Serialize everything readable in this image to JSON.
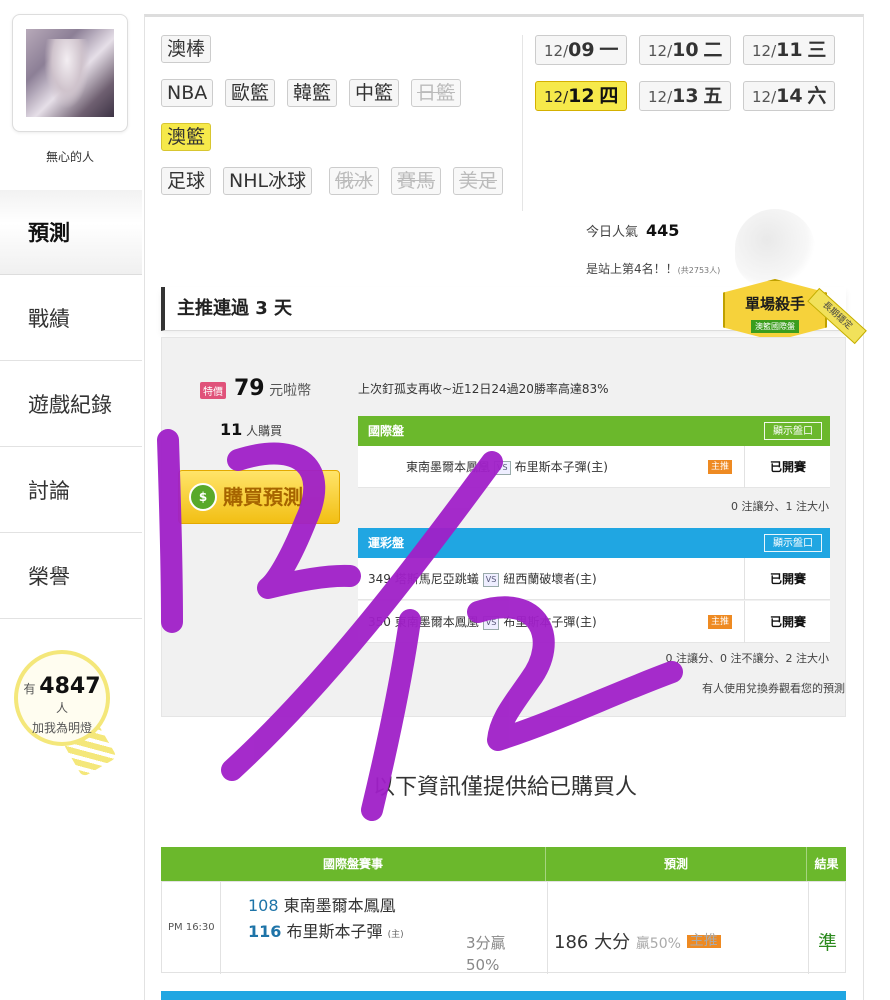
{
  "user": {
    "name": "無心的人"
  },
  "nav": [
    {
      "label": "預測",
      "active": true
    },
    {
      "label": "戰績",
      "active": false
    },
    {
      "label": "遊戲紀錄",
      "active": false
    },
    {
      "label": "討論",
      "active": false
    },
    {
      "label": "榮譽",
      "active": false
    }
  ],
  "lamp": {
    "prefix": "有",
    "count": "4847",
    "suffix": "人",
    "text": "加我為明燈"
  },
  "sports": [
    {
      "label": "澳棒",
      "state": "normal"
    },
    {
      "label": "NBA",
      "state": "normal"
    },
    {
      "label": "歐籃",
      "state": "normal"
    },
    {
      "label": "韓籃",
      "state": "normal"
    },
    {
      "label": "中籃",
      "state": "normal"
    },
    {
      "label": "日籃",
      "state": "disabled"
    },
    {
      "label": "澳籃",
      "state": "active"
    },
    {
      "label": "足球",
      "state": "normal"
    },
    {
      "label": "NHL冰球",
      "state": "normal"
    },
    {
      "label": "俄冰",
      "state": "disabled"
    },
    {
      "label": "賽馬",
      "state": "disabled"
    },
    {
      "label": "美足",
      "state": "disabled"
    }
  ],
  "dates": [
    {
      "month": "12/",
      "day": "09",
      "weekday": "一",
      "active": false
    },
    {
      "month": "12/",
      "day": "10",
      "weekday": "二",
      "active": false
    },
    {
      "month": "12/",
      "day": "11",
      "weekday": "三",
      "active": false
    },
    {
      "month": "12/",
      "day": "12",
      "weekday": "四",
      "active": true
    },
    {
      "month": "12/",
      "day": "13",
      "weekday": "五",
      "active": false
    },
    {
      "month": "12/",
      "day": "14",
      "weekday": "六",
      "active": false
    }
  ],
  "popularity": {
    "label": "今日人氣",
    "value": "445",
    "rank": "是站上第4名！！",
    "rank_note": "(共2753人)"
  },
  "section": {
    "title": "主推連過 3 天"
  },
  "badge": {
    "main": "單場殺手",
    "sub": "澳籃國際盤",
    "ribbon": "長期穩定"
  },
  "offer": {
    "special": "特價",
    "price": "79",
    "price_unit": "元啦幣",
    "buyers": "11",
    "buyers_unit": "人購買",
    "buy_icon": "$",
    "buy_label": "購買預測",
    "record": "上次釘孤支再收~近12日24過20勝率高達83%"
  },
  "intl_table": {
    "title": "國際盤",
    "show": "顯示盤口",
    "rows": [
      {
        "num": "",
        "home": "東南墨爾本鳳凰",
        "away": "布里斯本子彈(主)",
        "tag": "主推",
        "status": "已開賽"
      }
    ],
    "note": "0 注讓分、1 注大小"
  },
  "lottery_table": {
    "title": "運彩盤",
    "show": "顯示盤口",
    "rows": [
      {
        "num": "349",
        "home": "塔斯馬尼亞跳蟻",
        "away": "紐西蘭破壞者(主)",
        "tag": "",
        "status": "已開賽"
      },
      {
        "num": "350",
        "home": "東南墨爾本鳳凰",
        "away": "布里斯本子彈(主)",
        "tag": "主推",
        "status": "已開賽"
      }
    ],
    "note": "0 注讓分、0 注不讓分、2 注大小",
    "note2": "有人使用兌換券觀看您的預測"
  },
  "info_line": "以下資訊僅提供給已購買人",
  "bottom_table": {
    "headers": [
      "國際盤賽事",
      "預測",
      "結果"
    ],
    "row": {
      "time": "PM 16:30",
      "team1_num": "108",
      "team1": "東南墨爾本鳳凰",
      "team2_num": "116",
      "team2": "布里斯本子彈",
      "team2_tag": "(主)",
      "line": "3分贏",
      "line_pct": "50%",
      "prediction": "186 大分",
      "prediction_pct": "贏50%",
      "prediction_tag": "主推",
      "result": "準"
    }
  },
  "overlay": {
    "handwriting": "12/12",
    "color": "#a020c8"
  }
}
